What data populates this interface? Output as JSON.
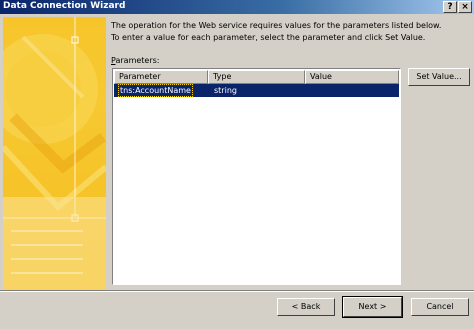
{
  "window": {
    "title": "Data Connection Wizard",
    "help_label": "?",
    "close_label": "×"
  },
  "instructions": {
    "line1": "The operation for the Web service requires values for the parameters listed below.",
    "line2": "To enter a value for each parameter, select the parameter and click Set Value."
  },
  "parameters": {
    "label_prefix": "P",
    "label_rest": "arameters:",
    "columns": [
      "Parameter",
      "Type",
      "Value"
    ],
    "rows": [
      {
        "parameter": "tns:AccountName",
        "type": "string",
        "value": ""
      }
    ]
  },
  "buttons": {
    "set_value": "Set Value...",
    "back": "< Back",
    "next": "Next >",
    "cancel": "Cancel"
  },
  "colors": {
    "title_bar": "#0a246a",
    "selection": "#0a246a",
    "art_panel": "#f6c52a"
  }
}
